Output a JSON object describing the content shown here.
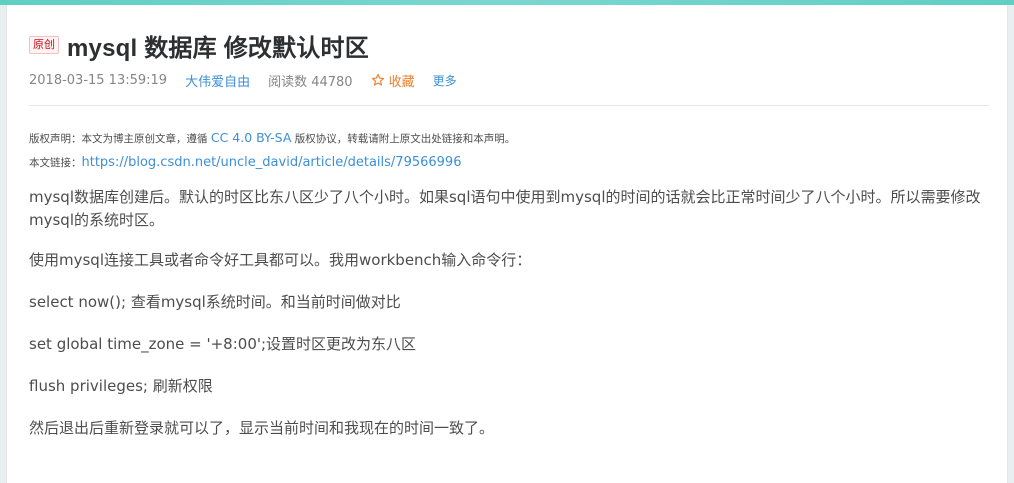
{
  "article": {
    "badge": "原创",
    "title": "mysql 数据库 修改默认时区",
    "meta": {
      "timestamp": "2018-03-15 13:59:19",
      "author": "大伟爱自由",
      "reads": "阅读数 44780",
      "collect": "收藏",
      "more": "更多"
    },
    "copyright": {
      "prefix": "版权声明：本文为博主原创文章，遵循 ",
      "license": "CC 4.0 BY-SA",
      "suffix": " 版权协议，转载请附上原文出处链接和本声明。",
      "link_label": "本文链接：",
      "link_url": "https://blog.csdn.net/uncle_david/article/details/79566996"
    },
    "paragraphs": [
      "mysql数据库创建后。默认的时区比东八区少了八个小时。如果sql语句中使用到mysql的时间的话就会比正常时间少了八个小时。所以需要修改mysql的系统时区。",
      "使用mysql连接工具或者命令好工具都可以。我用workbench输入命令行：",
      "select now(); 查看mysql系统时间。和当前时间做对比",
      "set global time_zone = '+8:00';设置时区更改为东八区",
      "flush privileges; 刷新权限",
      "然后退出后重新登录就可以了，显示当前时间和我现在的时间一致了。"
    ]
  },
  "icons": {
    "collect": "star-icon"
  },
  "colors": {
    "accent_link": "#3d8fd5",
    "collect": "#ed7f2d",
    "badge": "#ca0c16"
  }
}
